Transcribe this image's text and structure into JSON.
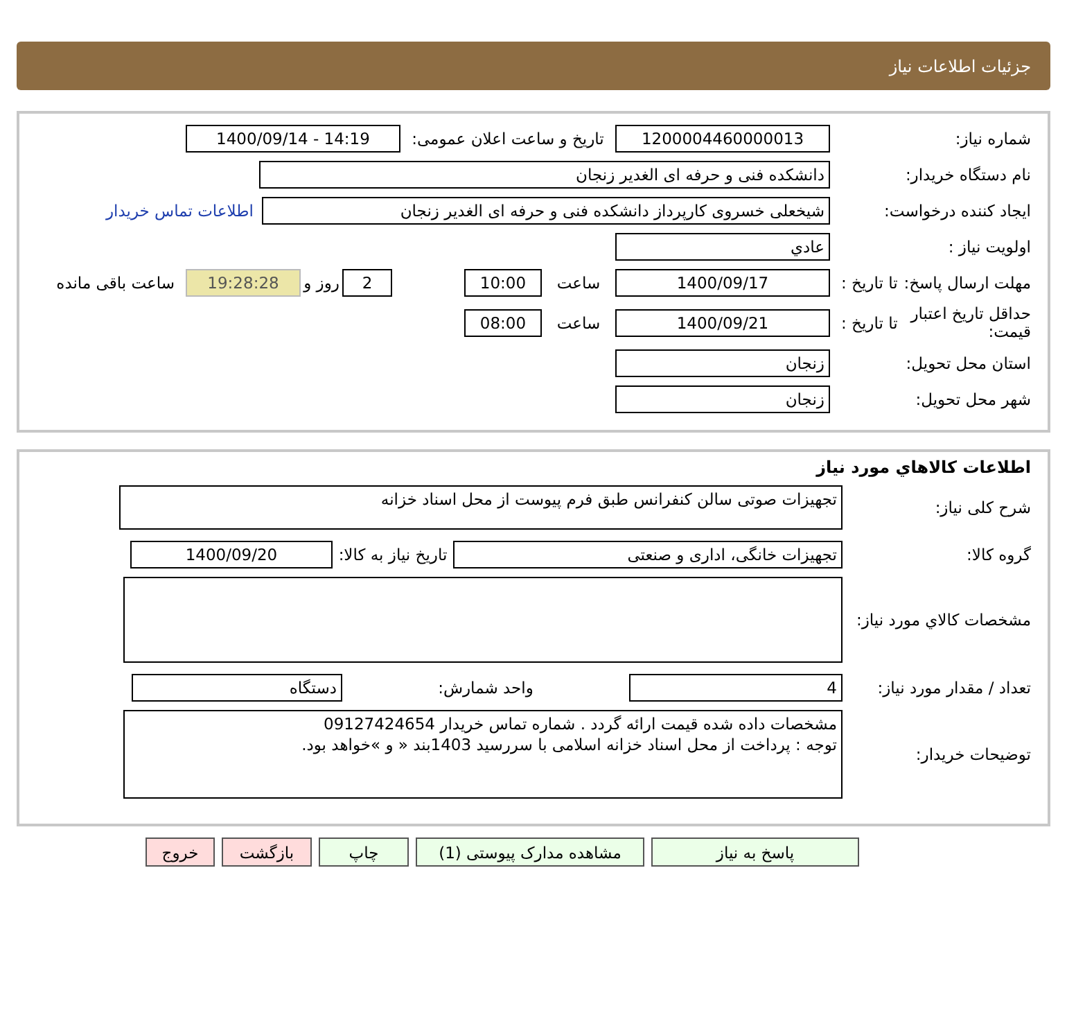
{
  "page_title": "جزئیات اطلاعات نیاز",
  "need_info": {
    "need_number": {
      "label": "شماره نیاز:",
      "value": "1200004460000013"
    },
    "announce": {
      "label": "تاریخ و ساعت اعلان عمومی:",
      "value": "1400/09/14 - 14:19"
    },
    "buyer_org": {
      "label": "نام دستگاه خریدار:",
      "value": "دانشکده فنی و حرفه ای الغدیر زنجان"
    },
    "requester": {
      "label": "ایجاد کننده درخواست:",
      "value": "شیخعلی خسروی کارپرداز دانشکده فنی و حرفه ای الغدیر زنجان",
      "link": "اطلاعات تماس خریدار"
    },
    "priority": {
      "label": "اولویت نیاز :",
      "value": "عادي"
    },
    "reply_deadline": {
      "label": "مهلت ارسال پاسخ:",
      "to_label": "تا تاریخ :",
      "date": "1400/09/17",
      "time_label": "ساعت",
      "time": "10:00",
      "days": "2",
      "days_label": "روز و",
      "remaining": "19:28:28",
      "remaining_label": "ساعت باقی مانده"
    },
    "price_validity": {
      "label": "حداقل تاریخ اعتبار قیمت:",
      "to_label": "تا تاریخ :",
      "date": "1400/09/21",
      "time_label": "ساعت",
      "time": "08:00"
    },
    "province": {
      "label": "استان محل تحویل:",
      "value": "زنجان"
    },
    "city": {
      "label": "شهر محل تحویل:",
      "value": "زنجان"
    }
  },
  "goods": {
    "title": "اطلاعات کالاهاي مورد نياز",
    "description": {
      "label": "شرح کلی نیاز:",
      "value": "تجهیزات صوتی سالن کنفرانس طبق فرم پیوست از محل اسناد خزانه"
    },
    "group": {
      "label": "گروه کالا:",
      "value": "تجهیزات خانگی، اداری و صنعتی"
    },
    "need_date": {
      "label": "تاریخ نیاز به کالا:",
      "value": "1400/09/20"
    },
    "specs": {
      "label": "مشخصات کالاي مورد نياز:"
    },
    "quantity": {
      "label": "تعداد / مقدار مورد نیاز:",
      "value": "4"
    },
    "unit": {
      "label": "واحد شمارش:",
      "value": "دستگاه"
    },
    "buyer_notes": {
      "label": "توضیحات خریدار:",
      "value": " مشخصات داده شده قیمت ارائه گردد . شماره تماس خریدار 09127424654\nتوجه : پرداخت از محل اسناد خزانه اسلامی با سررسید 1403بند « و »خواهد بود."
    }
  },
  "buttons": [
    {
      "label": "پاسخ به نیاز",
      "kind": "primary"
    },
    {
      "label": "مشاهده مدارک پیوستی (1)",
      "kind": "primary"
    },
    {
      "label": "چاپ",
      "kind": "primary"
    },
    {
      "label": "بازگشت",
      "kind": "danger"
    },
    {
      "label": "خروج",
      "kind": "danger"
    }
  ]
}
